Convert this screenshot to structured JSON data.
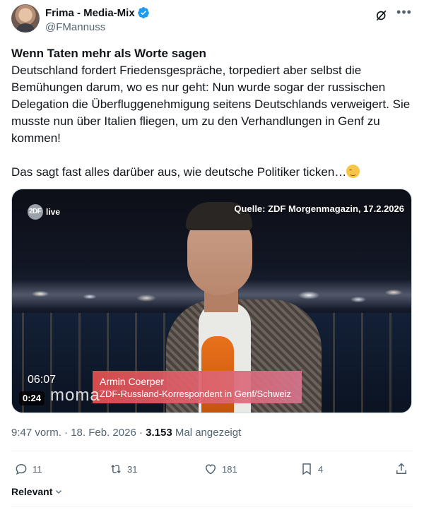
{
  "author": {
    "display_name": "Frima - Media-Mix",
    "handle": "@FMannuss",
    "verified": true,
    "verified_color": "#1d9bf0"
  },
  "tweet": {
    "title": "Wenn Taten mehr als Worte sagen",
    "paragraph1": "Deutschland fordert Friedensgespräche, torpediert aber selbst die Bemühungen darum, wo es nur geht: Nun wurde sogar der russischen Delegation die Überfluggenehmigung seitens Deutschlands verweigert. Sie musste nun über Italien fliegen, um zu den Verhandlungen in Genf zu kommen!",
    "paragraph2": "Das sagt fast alles darüber aus, wie deutsche Politiker ticken…",
    "emoji": "smiling-face-emoji"
  },
  "video": {
    "channel_live": "live",
    "source_caption": "Quelle: ZDF Morgenmagazin, 17.2.2026",
    "lower_third_name": "Armin Coerper",
    "lower_third_role": "ZDF-Russland-Korrespondent in Genf/Schweiz",
    "clock": "06:07",
    "show_logo": "moma",
    "duration": "0:24"
  },
  "meta": {
    "time": "9:47 vorm.",
    "separator": "·",
    "date": "18. Feb. 2026",
    "views": "3.153",
    "views_label": "Mal angezeigt"
  },
  "actions": {
    "replies": "11",
    "reposts": "31",
    "likes": "181",
    "bookmarks": "4"
  },
  "footer": {
    "relevant_label": "Relevant"
  }
}
